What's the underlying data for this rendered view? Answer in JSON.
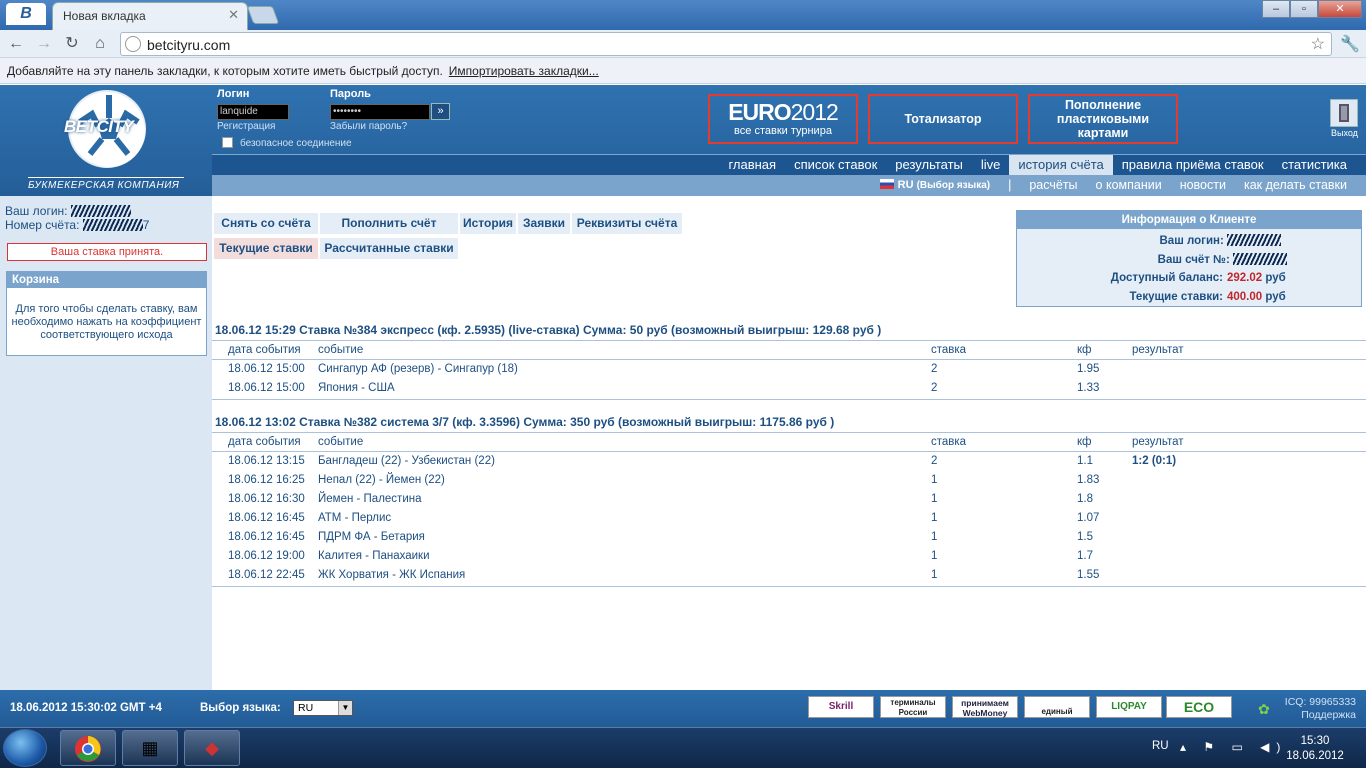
{
  "browser": {
    "tab_title": "Новая вкладка",
    "url": "betcityru.com",
    "bookmarks_msg": "Добавляйте на эту панель закладки, к которым хотите иметь быстрый доступ.",
    "import_link": "Импортировать закладки..."
  },
  "header": {
    "logo_text": "BETCITY",
    "logo_sub": "БУКМЕКЕРСКАЯ КОМПАНИЯ",
    "login_label": "Логин",
    "password_label": "Пароль",
    "login_value": "lanquide",
    "password_value": "••••••••",
    "register_link": "Регистрация",
    "forgot_link": "Забыли пароль?",
    "secure_label": "безопасное соединение",
    "promo_euro_top": "EURO",
    "promo_euro_year": "2012",
    "promo_euro_sub": "все ставки турнира",
    "promo_tote": "Тотализатор",
    "promo_cards": "Пополнение пластиковыми картами",
    "exit_label": "Выход"
  },
  "mainnav": [
    "главная",
    "список ставок",
    "результаты",
    "live",
    "история счёта",
    "правила приёма ставок",
    "статистика"
  ],
  "subnav": {
    "lang": "RU",
    "lang_note": "(Выбор языка)",
    "sep": "|",
    "items": [
      "расчёты",
      "о компании",
      "новости",
      "как делать ставки"
    ]
  },
  "left": {
    "login_label": "Ваш логин:",
    "account_label": "Номер счёта:",
    "account_tail": "7",
    "bet_accepted": "Ваша ставка принята.",
    "cart_title": "Корзина",
    "cart_text": "Для того чтобы сделать ставку, вам необходимо нажать на коэффициент соответствующего исхода"
  },
  "account_tabs": {
    "withdraw": "Снять со счёта",
    "deposit": "Пополнить счёт",
    "history": "История",
    "requests": "Заявки",
    "requisites": "Реквизиты счёта",
    "current": "Текущие ставки",
    "settled": "Рассчитанные ставки"
  },
  "client_info": {
    "title": "Информация о Клиенте",
    "login_label": "Ваш логин:",
    "account_label": "Ваш счёт №:",
    "balance_label": "Доступный баланс:",
    "balance": "292.02",
    "balance_cur": "руб",
    "current_label": "Текущие ставки:",
    "current": "400.00",
    "current_cur": "руб"
  },
  "columns": [
    "дата события",
    "событие",
    "ставка",
    "кф",
    "результат"
  ],
  "bets": [
    {
      "title": "18.06.12 15:29  Ставка №384  экспресс (кф. 2.5935)  (live-ставка) Сумма: 50 руб (возможный выигрыш: 129.68 руб )",
      "rows": [
        [
          "18.06.12 15:00",
          "Сингапур АФ (резерв) - Сингапур (18)",
          "2",
          "1.95",
          ""
        ],
        [
          "18.06.12 15:00",
          "Япония - США",
          "2",
          "1.33",
          ""
        ]
      ]
    },
    {
      "title": "18.06.12 13:02  Ставка №382  система 3/7 (кф. 3.3596)   Сумма: 350 руб (возможный выигрыш: 1175.86 руб )",
      "rows": [
        [
          "18.06.12 13:15",
          "Бангладеш (22) - Узбекистан (22)",
          "2",
          "1.1",
          "1:2 (0:1)"
        ],
        [
          "18.06.12 16:25",
          "Непал (22) - Йемен (22)",
          "1",
          "1.83",
          ""
        ],
        [
          "18.06.12 16:30",
          "Йемен - Палестина",
          "1",
          "1.8",
          ""
        ],
        [
          "18.06.12 16:45",
          "АТМ - Перлис",
          "1",
          "1.07",
          ""
        ],
        [
          "18.06.12 16:45",
          "ПДРМ ФА - Бетария",
          "1",
          "1.5",
          ""
        ],
        [
          "18.06.12 19:00",
          "Калитея - Панахаики",
          "1",
          "1.7",
          ""
        ],
        [
          "18.06.12 22:45",
          "ЖК Хорватия - ЖК Испания",
          "1",
          "1.55",
          ""
        ]
      ]
    }
  ],
  "footer": {
    "datetime": "18.06.2012  15:30:02  GMT +4",
    "lang_label": "Выбор языка:",
    "lang_value": "RU",
    "pay": [
      "Skrill",
      "терминалы России",
      "принимаем WebMoney",
      "единый кошелёк",
      "LIQPAY",
      "ECO"
    ],
    "icq": "ICQ: 99965333",
    "support": "Поддержка"
  },
  "taskbar": {
    "lang": "RU",
    "time": "15:30",
    "date": "18.06.2012"
  }
}
